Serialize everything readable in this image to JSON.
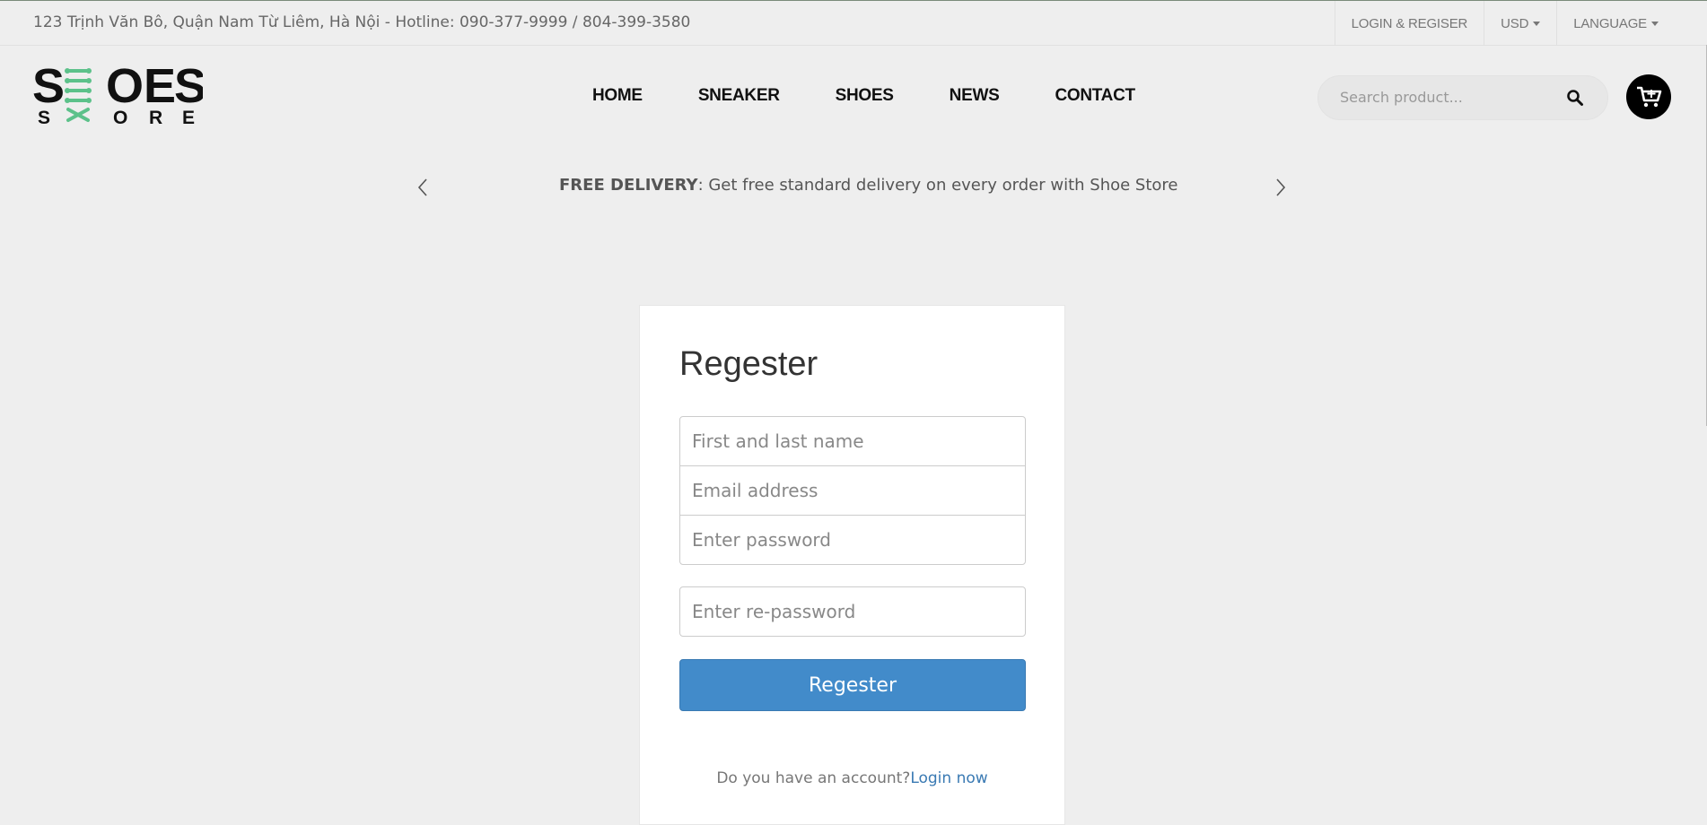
{
  "topbar": {
    "address": "123 Trịnh Văn Bô, Quận Nam Từ Liêm, Hà Nội - Hotline: 090-377-9999 / 804-399-3580",
    "login_label": "LOGIN & REGISER",
    "currency_label": "USD",
    "language_label": "LANGUAGE"
  },
  "logo": {
    "line1": "SHOES",
    "line2": "STORE",
    "accent_color": "#5cc18a"
  },
  "nav": {
    "items": [
      "HOME",
      "SNEAKER",
      "SHOES",
      "NEWS",
      "CONTACT"
    ]
  },
  "search": {
    "placeholder": "Search product..."
  },
  "icons": {
    "search": "search-icon",
    "cart": "cart-icon",
    "prev": "chevron-left-icon",
    "next": "chevron-right-icon"
  },
  "promo": {
    "bold": "FREE DELIVERY",
    "text": ": Get free standard delivery on every order with Shoe Store"
  },
  "form": {
    "title": "Regester",
    "name_placeholder": "First and last name",
    "email_placeholder": "Email address",
    "password_placeholder": "Enter password",
    "repassword_placeholder": "Enter re-password",
    "submit_label": "Regester",
    "account_question": "Do you have an account?",
    "login_link": "Login now"
  },
  "colors": {
    "background": "#eeeeee",
    "primary_button": "#428bca",
    "link": "#3a7ab3"
  }
}
